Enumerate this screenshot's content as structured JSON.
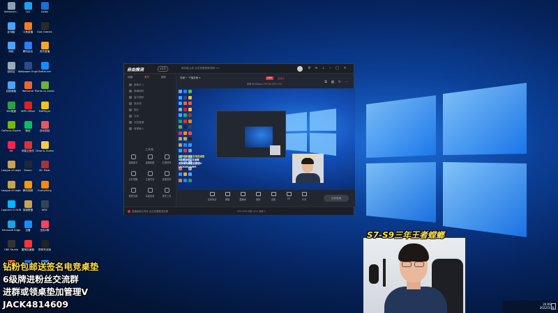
{
  "desktop": {
    "icons": [
      {
        "label": "Administr...",
        "color": "#8aa0b8"
      },
      {
        "label": "此电脑",
        "color": "#4aa3ff"
      },
      {
        "label": "网络",
        "color": "#4aa3ff"
      },
      {
        "label": "回收站",
        "color": "#9ab"
      },
      {
        "label": "控制面板",
        "color": "#4aa3ff"
      },
      {
        "label": "360极速",
        "color": "#2ea043"
      },
      {
        "label": "GeForce Experience",
        "color": "#76b900"
      },
      {
        "label": "EA",
        "color": "#f25"
      },
      {
        "label": "League of Legends",
        "color": "#c9a44a"
      },
      {
        "label": "League of Legends",
        "color": "#c9a44a"
      },
      {
        "label": "Logitech G HUB",
        "color": "#00b8fc"
      },
      {
        "label": "Microsoft Edge",
        "color": "#1fa0e0"
      },
      {
        "label": "OBS Studio",
        "color": "#333"
      },
      {
        "label": "Origin",
        "color": "#f56c2d"
      },
      {
        "label": "QQ",
        "color": "#1ea1f1"
      },
      {
        "label": "斗鱼直播",
        "color": "#ff7a1a"
      },
      {
        "label": "腾讯会议",
        "color": "#2e7cf6"
      },
      {
        "label": "Wallpaper Engine",
        "color": "#2b4c8c"
      },
      {
        "label": "WeGame",
        "color": "#e63"
      },
      {
        "label": "WPS Office",
        "color": "#d22"
      },
      {
        "label": "微信",
        "color": "#07c160"
      },
      {
        "label": "网易云音乐",
        "color": "#d33"
      },
      {
        "label": "Steam",
        "color": "#1b2838"
      },
      {
        "label": "腾讯视频",
        "color": "#f90"
      },
      {
        "label": "英雄联盟",
        "color": "#c9a44a"
      },
      {
        "label": "迅雷",
        "color": "#1a8cff"
      },
      {
        "label": "雷神加速器",
        "color": "#f33"
      },
      {
        "label": "Studio One",
        "color": "#2f6fcb"
      },
      {
        "label": "Uplay",
        "color": "#1c6fd6"
      },
      {
        "label": "Epic Games",
        "color": "#2a2a2a"
      },
      {
        "label": "虎牙直播",
        "color": "#f9a825"
      },
      {
        "label": "Battle.net",
        "color": "#148eff"
      },
      {
        "label": "Plants vs Zombies",
        "color": "#6cb33f"
      },
      {
        "label": "PotPlayer",
        "color": "#f0c419"
      },
      {
        "label": "自动录制",
        "color": "#e55"
      },
      {
        "label": "Draw & Guess",
        "color": "#f7c948"
      },
      {
        "label": "Mr. Meat",
        "color": "#a33"
      },
      {
        "label": "Everything",
        "color": "#f80"
      },
      {
        "label": "WRC",
        "color": "#345"
      },
      {
        "label": "全民K歌",
        "color": "#f45"
      },
      {
        "label": "剪映专业版",
        "color": "#222"
      },
      {
        "label": "万能看图",
        "color": "#39f"
      }
    ]
  },
  "app": {
    "logo_text": "自由推流",
    "version": "v3.0",
    "notice": "新功能上线 点击查看更新说明 >>",
    "sidebar": {
      "tabs": [
        "场景",
        "素材",
        "插件"
      ],
      "active_tab": "素材",
      "items": [
        "摄像头 1",
        "屏幕捕获",
        "窗口捕获",
        "媒体源",
        "图片",
        "文本",
        "浏览器源",
        "音频输入"
      ],
      "toolbox_title": "工具箱",
      "tools": [
        "弹幕助手",
        "直播数据",
        "礼物特效",
        "定时提醒",
        "主播任务",
        "直播录制",
        "美颜设置",
        "高级设置",
        "更多工具"
      ]
    },
    "main": {
      "scene_header": "场景一  下播准备 ▾",
      "live_badge": "LIVE",
      "live_status": "直播中",
      "scene_buttons": [
        "全部场景",
        "分屏模式",
        "横屏模式"
      ],
      "stats": "码率 6000kbps   FPS 60   CPU 23%",
      "preview_promo": [
        "钻粉包邮送签名电竞桌垫",
        "6级牌进粉丝交流群",
        "进群或领桌垫加管理V",
        "JACK4814609"
      ],
      "preview_cam_label": "S7-S9三年王者螳螂",
      "toolbar": [
        "互动玩法",
        "弹幕",
        "直播间",
        "音效",
        "连麦",
        "PK",
        "分享"
      ],
      "start_live": "结束直播"
    },
    "status": {
      "text": "直播画面已同步 点击查看推流设置",
      "right": "CPU 23%  内存 41%  丢帧 0"
    }
  },
  "overlay": {
    "promo_lines": [
      "钻粉包邮送签名电竞桌垫",
      "6级牌进粉丝交流群",
      "进群或领桌垫加管理V",
      "JACK4814609"
    ],
    "cam_label": "S7-S9三年王者螳螂"
  },
  "taskbar": {
    "time": "20:06",
    "date": "2022/5/19"
  },
  "colors": {
    "accent_red": "#e0313f",
    "promo_yellow": "#ffe04a",
    "desktop_blue": "#0b3f96"
  }
}
